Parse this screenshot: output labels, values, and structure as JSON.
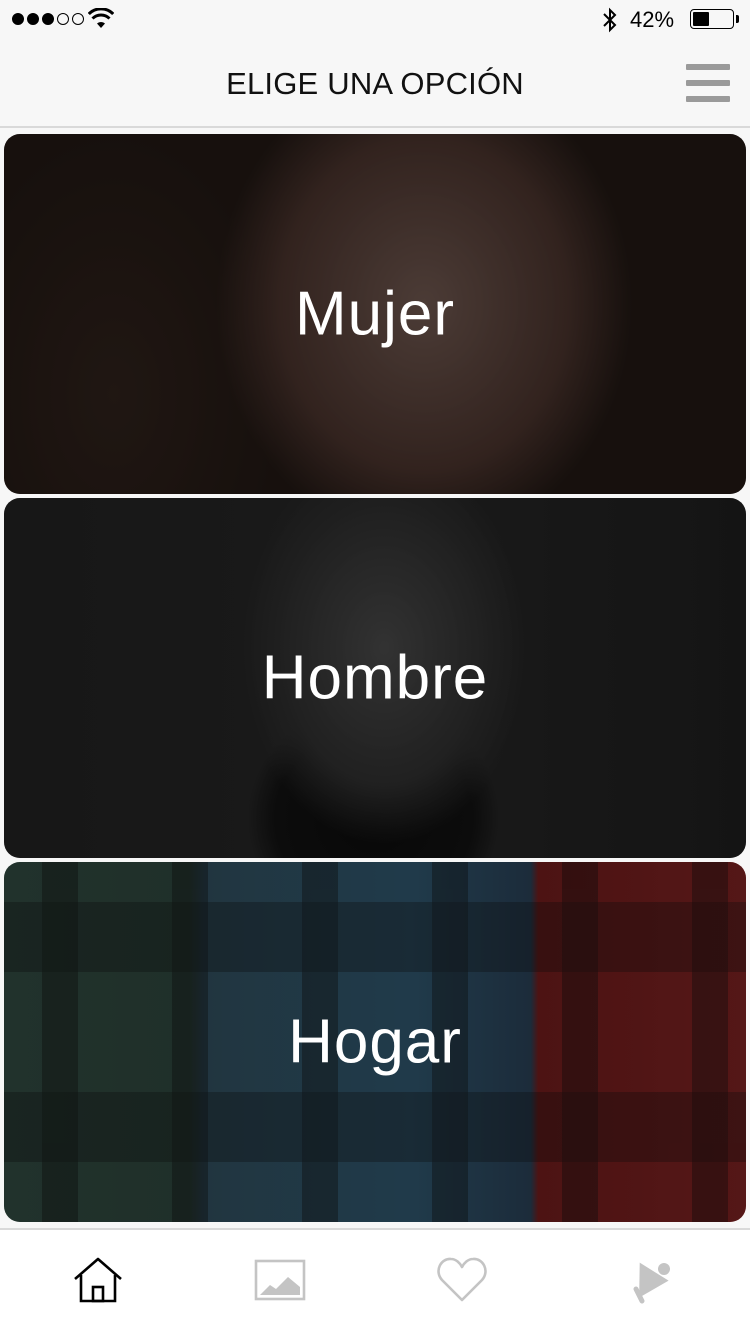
{
  "status_bar": {
    "signal_bars_filled": 3,
    "signal_bars_total": 5,
    "battery_percent_label": "42%",
    "battery_level": 0.42
  },
  "header": {
    "title": "ELIGE UNA OPCIÓN",
    "menu_icon": "hamburger-menu-icon"
  },
  "options": [
    {
      "label": "Mujer"
    },
    {
      "label": "Hombre"
    },
    {
      "label": "Hogar"
    }
  ],
  "tabbar": {
    "tabs": [
      {
        "icon": "home-icon",
        "active": true
      },
      {
        "icon": "image-icon",
        "active": false
      },
      {
        "icon": "heart-icon",
        "active": false
      },
      {
        "icon": "megaphone-icon",
        "active": false
      }
    ],
    "active_color": "#000000",
    "inactive_color": "#c4c4c4"
  }
}
